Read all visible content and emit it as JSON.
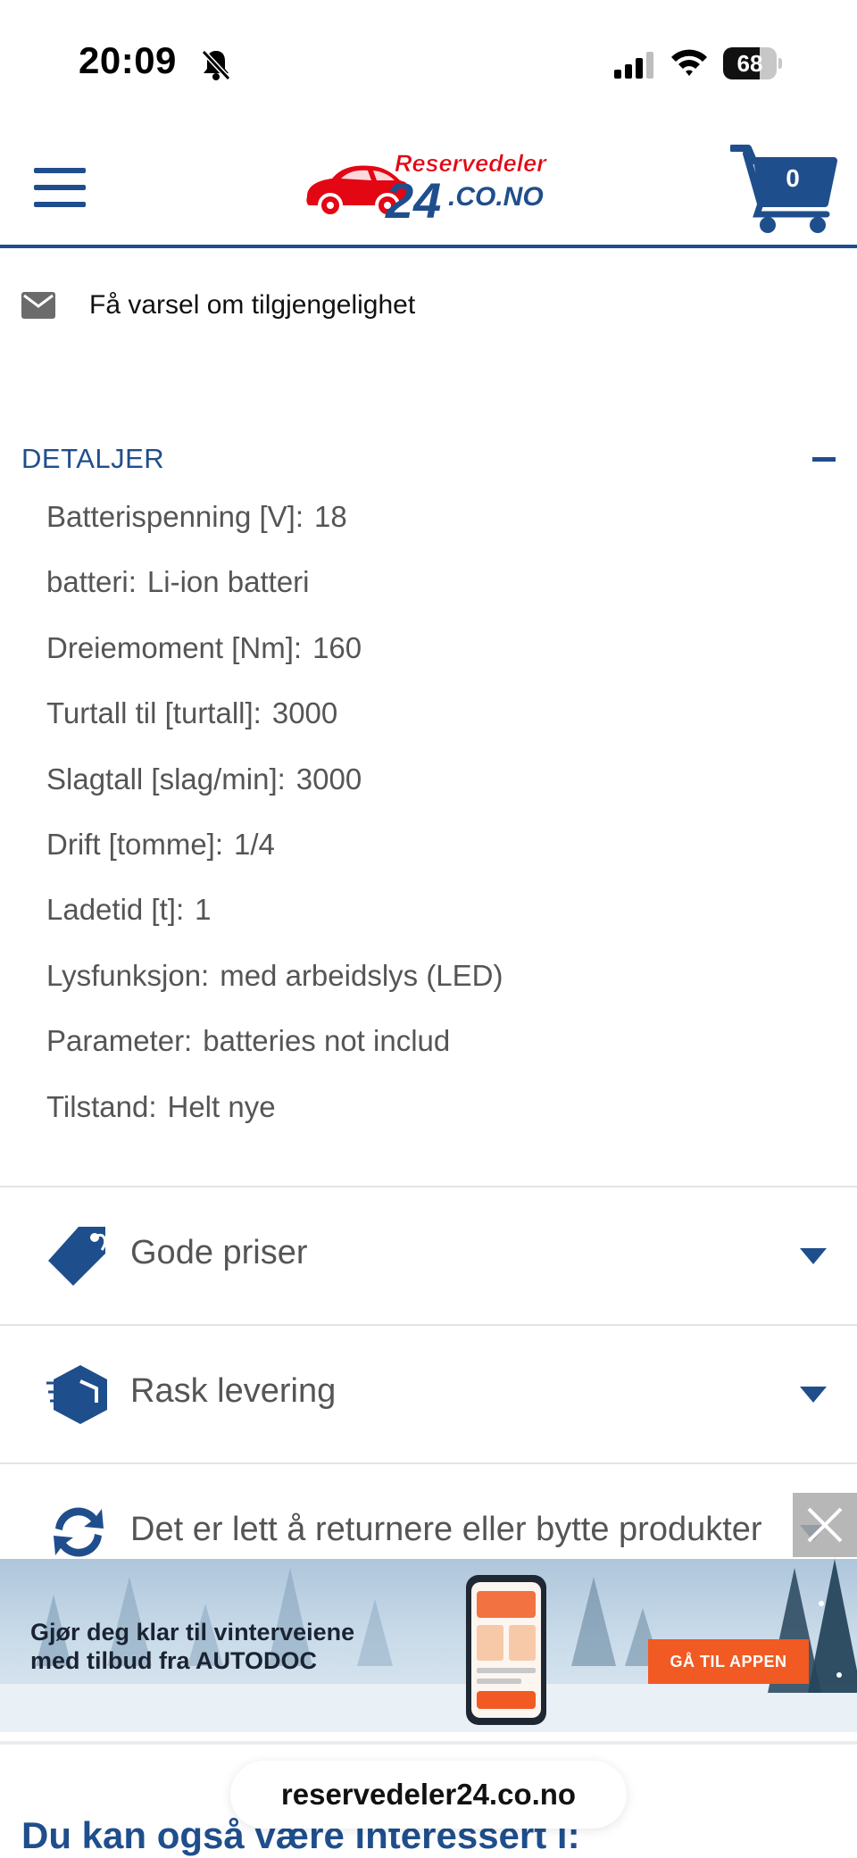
{
  "status_bar": {
    "time": "20:09",
    "battery_level": "68",
    "icons": [
      "bell-slash-icon",
      "cellular-signal-icon",
      "wifi-icon",
      "battery-icon"
    ]
  },
  "header": {
    "logo_text_top": "Reservedeler",
    "logo_text_main": "24",
    "logo_text_domain": ".CO.NO",
    "cart_count": "0",
    "colors": {
      "brand_blue": "#1f4e8c",
      "brand_red": "#e30613"
    }
  },
  "notify": {
    "label": "Få varsel om tilgjengelighet",
    "icon": "mail-icon"
  },
  "details": {
    "title": "DETALJER",
    "rows": [
      {
        "label": "Batterispenning [V]:",
        "value": "18"
      },
      {
        "label": "batteri:",
        "value": "Li-ion batteri"
      },
      {
        "label": "Dreiemoment [Nm]:",
        "value": "160"
      },
      {
        "label": "Turtall til [turtall]:",
        "value": "3000"
      },
      {
        "label": "Slagtall [slag/min]:",
        "value": "3000"
      },
      {
        "label": "Drift [tomme]:",
        "value": "1/4"
      },
      {
        "label": "Ladetid [t]:",
        "value": "1"
      },
      {
        "label": "Lysfunksjon:",
        "value": "med arbeidslys (LED)"
      },
      {
        "label": "Parameter:",
        "value": "batteries not includ"
      },
      {
        "label": "Tilstand:",
        "value": "Helt nye"
      }
    ]
  },
  "benefits": [
    {
      "label": "Gode priser",
      "icon": "price-tag-icon"
    },
    {
      "label": "Rask levering",
      "icon": "fast-delivery-icon"
    },
    {
      "label": "Det er lett å returnere eller bytte produkter",
      "icon": "return-exchange-icon"
    }
  ],
  "ad_banner": {
    "line1": "Gjør deg klar til vinterveiene",
    "line2": "med tilbud fra AUTODOC",
    "button": "GÅ TIL APPEN",
    "accent": "#f15a22"
  },
  "bottom": {
    "url": "reservedeler24.co.no",
    "interested_title": "Du kan også være interessert i:"
  }
}
